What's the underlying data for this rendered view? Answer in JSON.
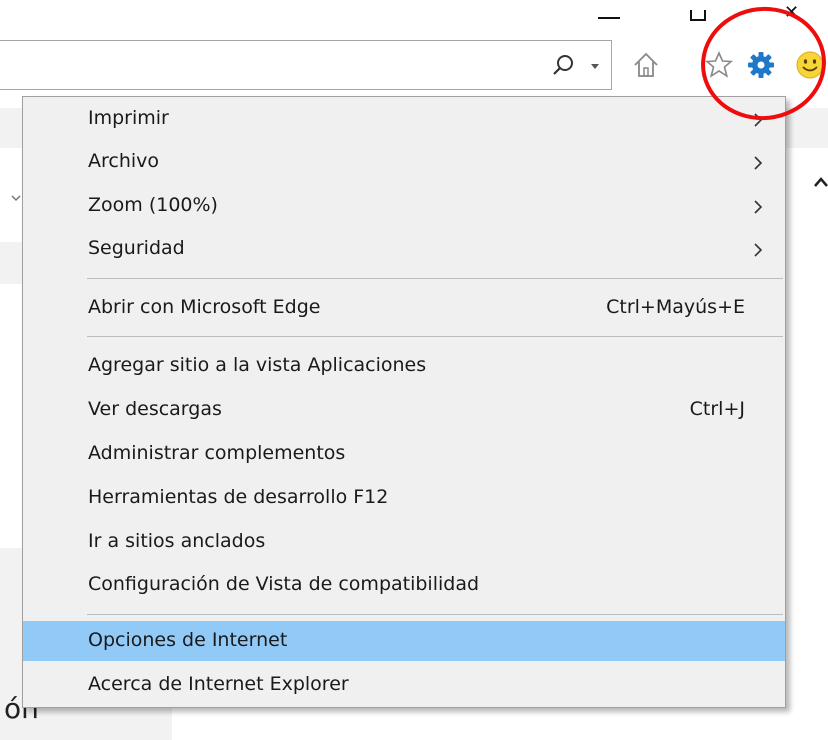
{
  "window": {
    "close_glyph": "✕"
  },
  "toolbar": {
    "icons": [
      "search-icon",
      "home-icon",
      "star-icon",
      "gear-icon",
      "smiley-icon"
    ],
    "highlight_color": "#ee0d0d"
  },
  "background": {
    "partial_text": "ón"
  },
  "menu": {
    "hover_color": "#91c9f7",
    "items": [
      {
        "label": "Imprimir",
        "has_submenu": true
      },
      {
        "label": "Archivo",
        "has_submenu": true
      },
      {
        "label": "Zoom (100%)",
        "has_submenu": true
      },
      {
        "label": "Seguridad",
        "has_submenu": true
      },
      {
        "label": "Abrir con Microsoft Edge",
        "shortcut": "Ctrl+Mayús+E"
      },
      {
        "label": "Agregar sitio a la vista Aplicaciones"
      },
      {
        "label": "Ver descargas",
        "shortcut": "Ctrl+J"
      },
      {
        "label": "Administrar complementos"
      },
      {
        "label": "Herramientas de desarrollo F12"
      },
      {
        "label": "Ir a sitios anclados"
      },
      {
        "label": "Configuración de Vista de compatibilidad"
      },
      {
        "label": "Opciones de Internet",
        "highlighted": true
      },
      {
        "label": "Acerca de Internet Explorer"
      }
    ]
  }
}
